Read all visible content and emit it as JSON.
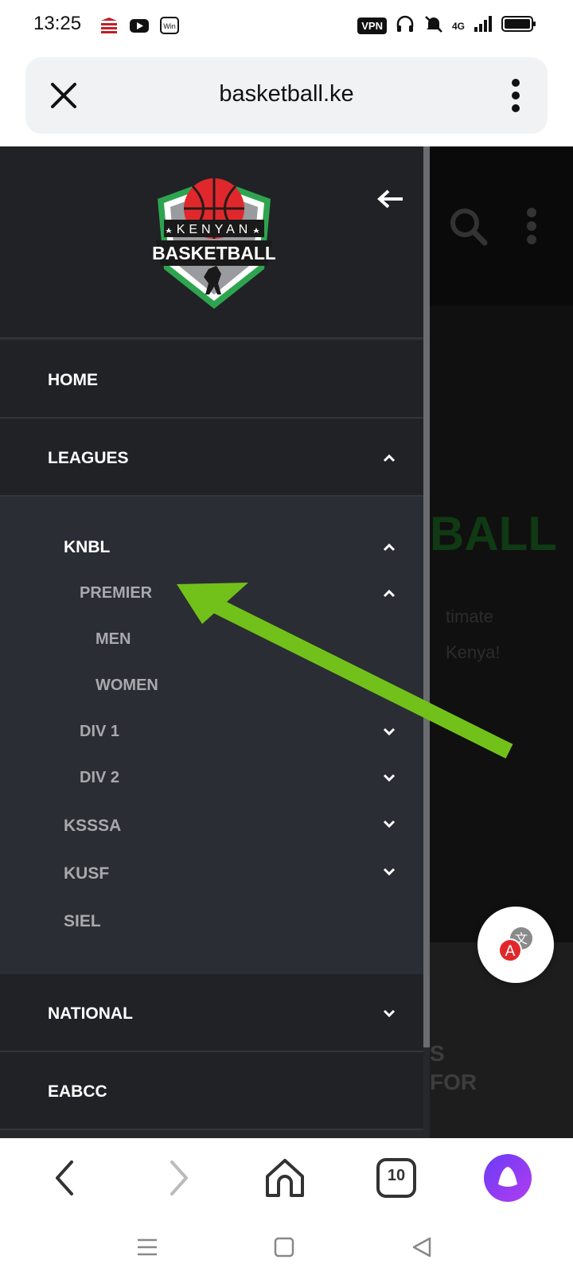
{
  "status_bar": {
    "time": "13:25",
    "left_icons": [
      "bank-app-icon",
      "youtube-icon",
      "win-app-icon"
    ],
    "vpn_label": "VPN",
    "network_label": "4G",
    "right_icons": [
      "headphones-icon",
      "mute-icon",
      "signal-icon",
      "battery-icon"
    ]
  },
  "address_bar": {
    "url": "basketball.ke"
  },
  "drawer": {
    "logo_text_top": "KENYAN",
    "logo_text_main": "BASKETBALL",
    "menu": [
      {
        "label": "HOME"
      },
      {
        "label": "LEAGUES",
        "expanded": true
      },
      {
        "label": "NATIONAL",
        "expanded": false
      },
      {
        "label": "EABCC"
      }
    ],
    "leagues_submenu": [
      {
        "label": "KNBL",
        "level": 1,
        "expanded": true
      },
      {
        "label": "PREMIER",
        "level": 2,
        "expanded": true
      },
      {
        "label": "MEN",
        "level": 3
      },
      {
        "label": "WOMEN",
        "level": 3
      },
      {
        "label": "DIV 1",
        "level": 2,
        "expanded": false
      },
      {
        "label": "DIV 2",
        "level": 2,
        "expanded": false
      },
      {
        "label": "KSSSA",
        "level": 1,
        "expanded": false
      },
      {
        "label": "KUSF",
        "level": 1,
        "expanded": false
      },
      {
        "label": "SIEL",
        "level": 1
      }
    ]
  },
  "page_behind": {
    "hero_title_fragment": "BALL",
    "hero_sub_1": "timate",
    "hero_sub_2": "Kenya!",
    "bottom_text_1": "S",
    "bottom_text_2": "FOR"
  },
  "browser_bar": {
    "tab_count": "10"
  },
  "colors": {
    "annotation_arrow": "#72c11a",
    "drawer_bg": "#26282c",
    "logo_green": "#2ea44f",
    "ball_red": "#e0282c"
  }
}
